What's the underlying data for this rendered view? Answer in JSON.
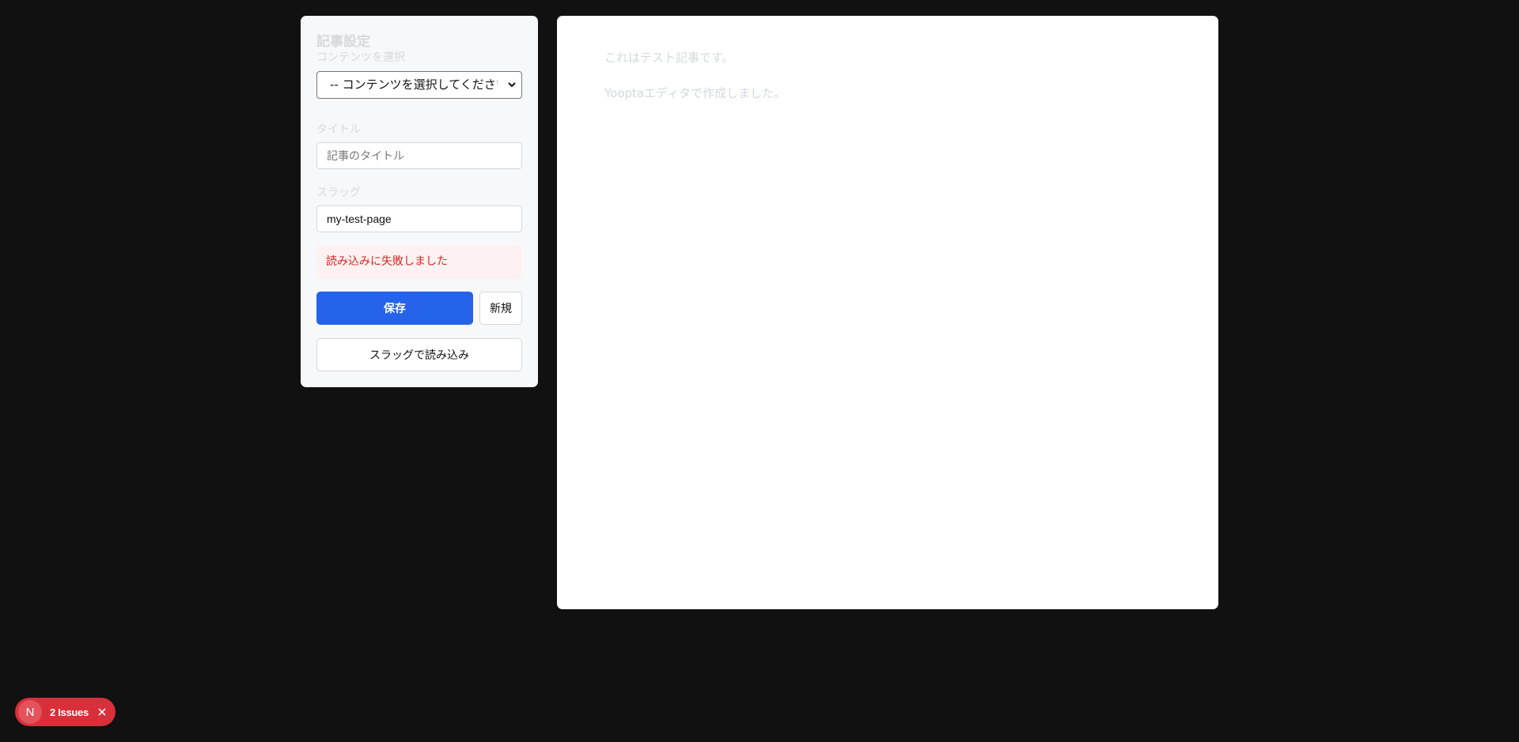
{
  "settings": {
    "title": "記事設定",
    "content_label": "コンテンツを選択",
    "content_select_value": "-- コンテンツを選択してください --",
    "title_label": "タイトル",
    "title_placeholder": "記事のタイトル",
    "slug_label": "スラッグ",
    "slug_value": "my-test-page",
    "error_message": "読み込みに失敗しました",
    "save_label": "保存",
    "new_label": "新規",
    "load_by_slug_label": "スラッグで読み込み"
  },
  "editor": {
    "paragraphs": [
      "これはテスト記事です。",
      "Yooptaエディタで作成しました。"
    ]
  },
  "dev_overlay": {
    "logo_letter": "N",
    "issues_label": "2 Issues"
  },
  "colors": {
    "background": "#111111",
    "primary": "#2563eb",
    "error_text": "#dc2626",
    "error_bg": "#fef1f1",
    "badge": "#d8303a"
  },
  "icons": [
    "chevron-down-icon",
    "close-icon",
    "next-logo-icon"
  ]
}
